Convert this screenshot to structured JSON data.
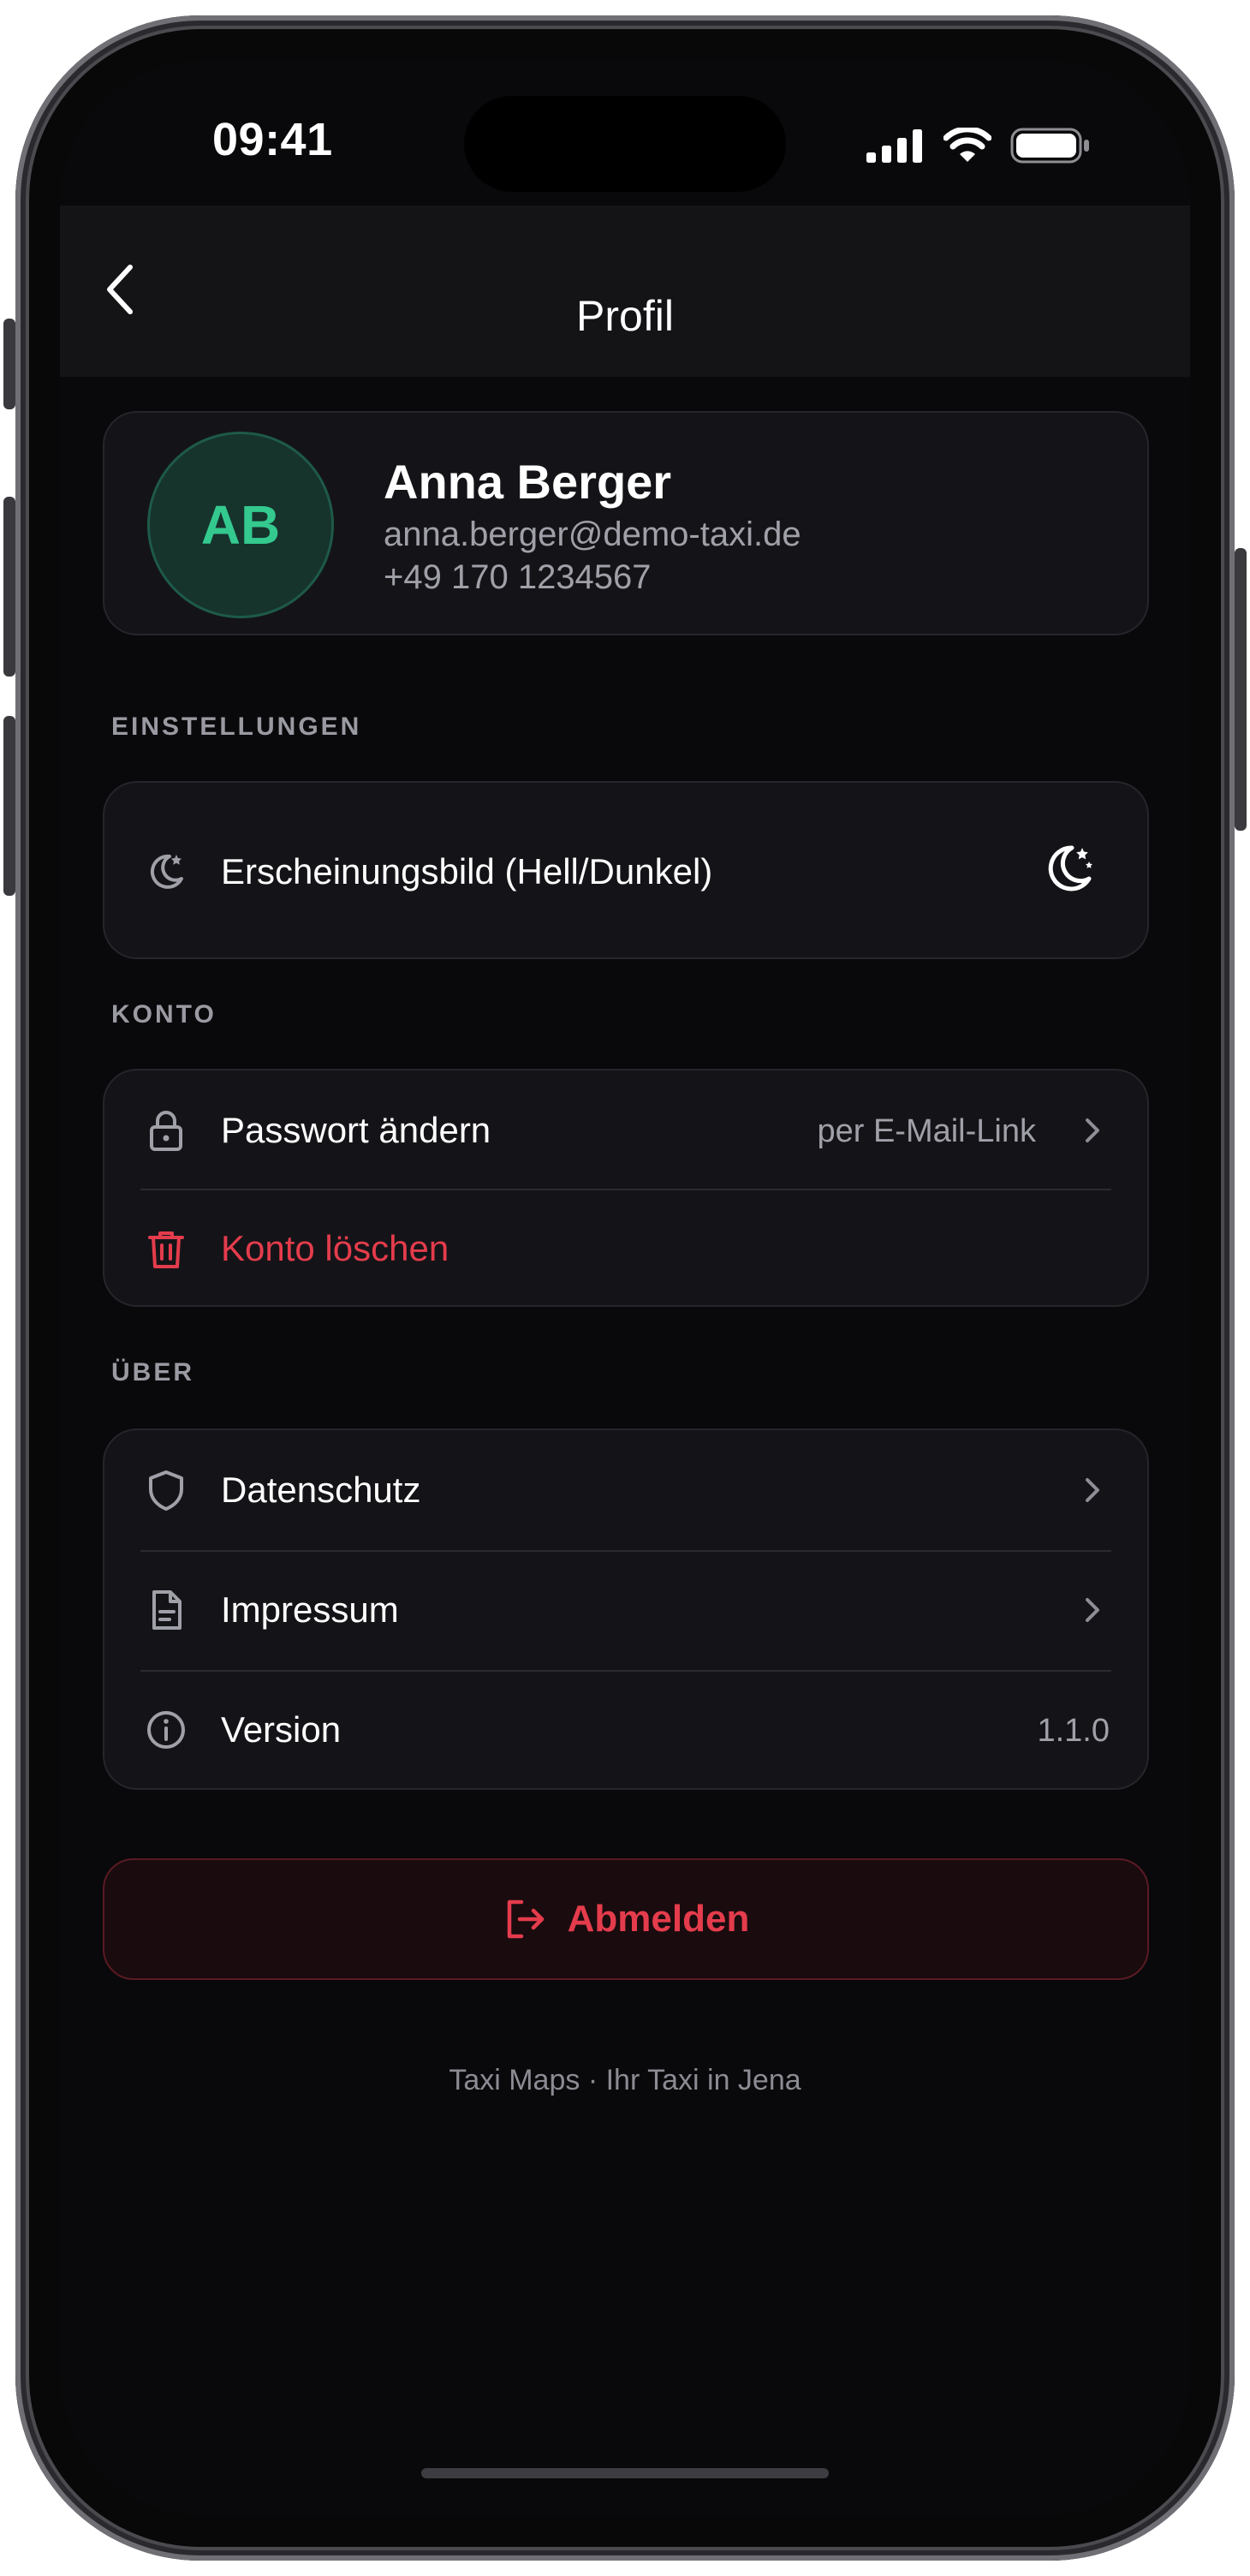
{
  "status_bar": {
    "time": "09:41"
  },
  "header": {
    "title": "Profil"
  },
  "profile": {
    "initials": "AB",
    "name": "Anna Berger",
    "email": "anna.berger@demo-taxi.de",
    "phone": "+49 170 1234567"
  },
  "sections": {
    "settings": {
      "label": "EINSTELLUNGEN",
      "appearance_label": "Erscheinungsbild (Hell/Dunkel)"
    },
    "account": {
      "label": "KONTO",
      "password_label": "Passwort ändern",
      "password_value": "per E-Mail-Link",
      "delete_label": "Konto löschen"
    },
    "about": {
      "label": "ÜBER",
      "privacy_label": "Datenschutz",
      "imprint_label": "Impressum",
      "version_label": "Version",
      "version_value": "1.1.0"
    }
  },
  "logout": {
    "label": "Abmelden"
  },
  "footer": {
    "text": "Taxi Maps · Ihr Taxi in Jena"
  },
  "colors": {
    "background": "#09090b",
    "card": "#141418",
    "accent_green": "#34c98f",
    "danger_red": "#e43c4c",
    "muted_text": "#a0a0a8"
  }
}
